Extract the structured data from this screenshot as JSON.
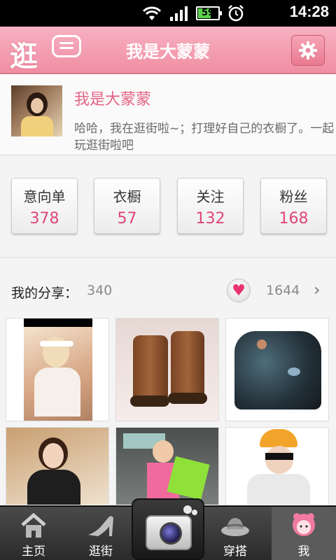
{
  "status_bar": {
    "time": "14:28",
    "battery": "59"
  },
  "header": {
    "title": "我是大蒙蒙",
    "logo_text": "逛"
  },
  "profile": {
    "username": "我是大蒙蒙",
    "bio": "哈哈，我在逛街啦~；打理好自己的衣橱了。一起玩逛街啦吧"
  },
  "stats": [
    {
      "label": "意向单",
      "value": "378"
    },
    {
      "label": "衣橱",
      "value": "57"
    },
    {
      "label": "关注",
      "value": "132"
    },
    {
      "label": "粉丝",
      "value": "168"
    }
  ],
  "shares": {
    "label": "我的分享：",
    "count": "340",
    "likes": "1644"
  },
  "grid": [
    {
      "name": "photo-girl-headband"
    },
    {
      "name": "photo-brown-boots"
    },
    {
      "name": "photo-galaxy-blouse"
    },
    {
      "name": "photo-girl-selfie"
    },
    {
      "name": "photo-shopping-girl"
    },
    {
      "name": "photo-hat-girl"
    }
  ],
  "nav": {
    "home": "主页",
    "browse": "逛街",
    "outfit": "穿搭",
    "me": "我"
  }
}
